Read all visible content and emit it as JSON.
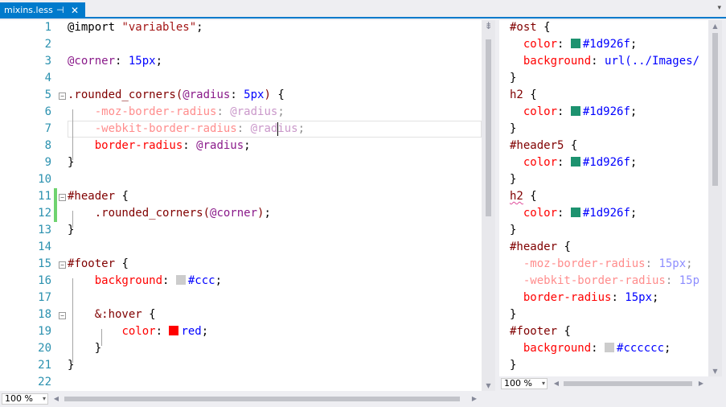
{
  "tab": {
    "title": "mixins.less",
    "pin_glyph": "⊣",
    "close_glyph": "✕",
    "overflow_glyph": "▾"
  },
  "zoom": {
    "left": "100 %",
    "right": "100 %"
  },
  "scroll": {
    "up": "▲",
    "down": "▼",
    "left": "◀",
    "right": "▶",
    "splitter": "⇟"
  },
  "swatches": {
    "green": "#1d926f",
    "gray": "#cccccc",
    "red": "#ff0000"
  },
  "left_lines": [
    [
      [
        "pun",
        "@import "
      ],
      [
        "str",
        "\"variables\""
      ],
      [
        "pun",
        ";"
      ]
    ],
    [],
    [
      [
        "var",
        "@corner"
      ],
      [
        "pun",
        ": "
      ],
      [
        "val",
        "15px"
      ],
      [
        "pun",
        ";"
      ]
    ],
    [],
    [
      [
        "sel",
        ".rounded_corners("
      ],
      [
        "var",
        "@radius"
      ],
      [
        "pun",
        ": "
      ],
      [
        "val",
        "5px"
      ],
      [
        "sel",
        ")"
      ],
      [
        "pun",
        " {"
      ]
    ],
    [
      [
        "pun",
        "    "
      ],
      [
        "prop dim",
        "-moz-border-radius"
      ],
      [
        "pun dim",
        ": "
      ],
      [
        "var dim",
        "@radius"
      ],
      [
        "pun dim",
        ";"
      ]
    ],
    [
      [
        "pun",
        "    "
      ],
      [
        "prop dim",
        "-webkit-border-radius"
      ],
      [
        "pun dim",
        ": "
      ],
      [
        "var dim",
        "@radius"
      ],
      [
        "pun dim",
        ";"
      ]
    ],
    [
      [
        "pun",
        "    "
      ],
      [
        "prop",
        "border-radius"
      ],
      [
        "pun",
        ": "
      ],
      [
        "var",
        "@radius"
      ],
      [
        "pun",
        ";"
      ]
    ],
    [
      [
        "pun",
        "}"
      ]
    ],
    [],
    [
      [
        "sel",
        "#header"
      ],
      [
        "pun",
        " {"
      ]
    ],
    [
      [
        "pun",
        "    "
      ],
      [
        "sel",
        ".rounded_corners("
      ],
      [
        "var",
        "@corner"
      ],
      [
        "sel",
        ")"
      ],
      [
        "pun",
        ";"
      ]
    ],
    [
      [
        "pun",
        "}"
      ]
    ],
    [],
    [
      [
        "sel",
        "#footer"
      ],
      [
        "pun",
        " {"
      ]
    ],
    [
      [
        "pun",
        "    "
      ],
      [
        "prop",
        "background"
      ],
      [
        "pun",
        ": "
      ],
      [
        "swatch",
        "gray"
      ],
      [
        "val",
        "#ccc"
      ],
      [
        "pun",
        ";"
      ]
    ],
    [],
    [
      [
        "pun",
        "    "
      ],
      [
        "sel",
        "&:hover"
      ],
      [
        "pun",
        " {"
      ]
    ],
    [
      [
        "pun",
        "        "
      ],
      [
        "prop",
        "color"
      ],
      [
        "pun",
        ": "
      ],
      [
        "swatch",
        "red"
      ],
      [
        "val",
        "red"
      ],
      [
        "pun",
        ";"
      ]
    ],
    [
      [
        "pun",
        "    }"
      ]
    ],
    [
      [
        "pun",
        "}"
      ]
    ],
    []
  ],
  "line_numbers": [
    "1",
    "2",
    "3",
    "4",
    "5",
    "6",
    "7",
    "8",
    "9",
    "10",
    "11",
    "12",
    "13",
    "14",
    "15",
    "16",
    "17",
    "18",
    "19",
    "20",
    "21",
    "22"
  ],
  "right_lines": [
    [
      [
        "sel",
        "#ost"
      ],
      [
        "pun",
        " {"
      ]
    ],
    [
      [
        "pun",
        "  "
      ],
      [
        "prop",
        "color"
      ],
      [
        "pun",
        ": "
      ],
      [
        "swatch",
        "green"
      ],
      [
        "val",
        "#1d926f"
      ],
      [
        "pun",
        ";"
      ]
    ],
    [
      [
        "pun",
        "  "
      ],
      [
        "prop",
        "background"
      ],
      [
        "pun",
        ": "
      ],
      [
        "val",
        "url(../Images/"
      ]
    ],
    [
      [
        "pun",
        "}"
      ]
    ],
    [
      [
        "sel",
        "h2"
      ],
      [
        "pun",
        " {"
      ]
    ],
    [
      [
        "pun",
        "  "
      ],
      [
        "prop",
        "color"
      ],
      [
        "pun",
        ": "
      ],
      [
        "swatch",
        "green"
      ],
      [
        "val",
        "#1d926f"
      ],
      [
        "pun",
        ";"
      ]
    ],
    [
      [
        "pun",
        "}"
      ]
    ],
    [
      [
        "sel",
        "#header5"
      ],
      [
        "pun",
        " {"
      ]
    ],
    [
      [
        "pun",
        "  "
      ],
      [
        "prop",
        "color"
      ],
      [
        "pun",
        ": "
      ],
      [
        "swatch",
        "green"
      ],
      [
        "val",
        "#1d926f"
      ],
      [
        "pun",
        ";"
      ]
    ],
    [
      [
        "pun",
        "}"
      ]
    ],
    [
      [
        "sel squig",
        "h2"
      ],
      [
        "pun",
        " {"
      ]
    ],
    [
      [
        "pun",
        "  "
      ],
      [
        "prop",
        "color"
      ],
      [
        "pun",
        ": "
      ],
      [
        "swatch",
        "green"
      ],
      [
        "val",
        "#1d926f"
      ],
      [
        "pun",
        ";"
      ]
    ],
    [
      [
        "pun",
        "}"
      ]
    ],
    [
      [
        "sel",
        "#header"
      ],
      [
        "pun",
        " {"
      ]
    ],
    [
      [
        "pun",
        "  "
      ],
      [
        "prop dim",
        "-moz-border-radius"
      ],
      [
        "pun dim",
        ": "
      ],
      [
        "val dim",
        "15px"
      ],
      [
        "pun dim",
        ";"
      ]
    ],
    [
      [
        "pun",
        "  "
      ],
      [
        "prop dim",
        "-webkit-border-radius"
      ],
      [
        "pun dim",
        ": "
      ],
      [
        "val dim",
        "15p"
      ]
    ],
    [
      [
        "pun",
        "  "
      ],
      [
        "prop",
        "border-radius"
      ],
      [
        "pun",
        ": "
      ],
      [
        "val",
        "15px"
      ],
      [
        "pun",
        ";"
      ]
    ],
    [
      [
        "pun",
        "}"
      ]
    ],
    [
      [
        "sel",
        "#footer"
      ],
      [
        "pun",
        " {"
      ]
    ],
    [
      [
        "pun",
        "  "
      ],
      [
        "prop",
        "background"
      ],
      [
        "pun",
        ": "
      ],
      [
        "swatch",
        "gray"
      ],
      [
        "val",
        "#cccccc"
      ],
      [
        "pun",
        ";"
      ]
    ],
    [
      [
        "pun",
        "}"
      ]
    ]
  ]
}
